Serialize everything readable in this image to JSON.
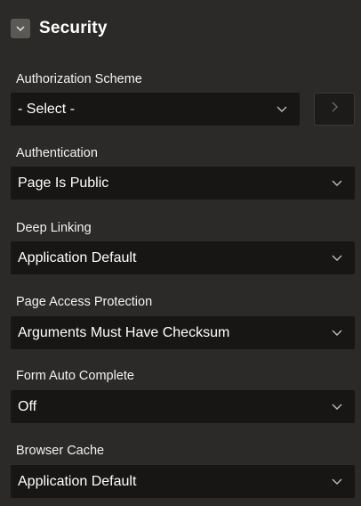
{
  "section": {
    "title": "Security",
    "toggle_icon": "chevron-down-icon"
  },
  "fields": {
    "authorization_scheme": {
      "label": "Authorization Scheme",
      "value": "- Select -",
      "nav_icon": "chevron-right-icon"
    },
    "authentication": {
      "label": "Authentication",
      "value": "Page Is Public"
    },
    "deep_linking": {
      "label": "Deep Linking",
      "value": "Application Default"
    },
    "page_access_protection": {
      "label": "Page Access Protection",
      "value": "Arguments Must Have Checksum"
    },
    "form_auto_complete": {
      "label": "Form Auto Complete",
      "value": "Off"
    },
    "browser_cache": {
      "label": "Browser Cache",
      "value": "Application Default"
    }
  },
  "colors": {
    "panel_background": "#2b2a28",
    "field_background": "#171614",
    "text": "#ffffff",
    "icon": "#bdbcb8"
  }
}
